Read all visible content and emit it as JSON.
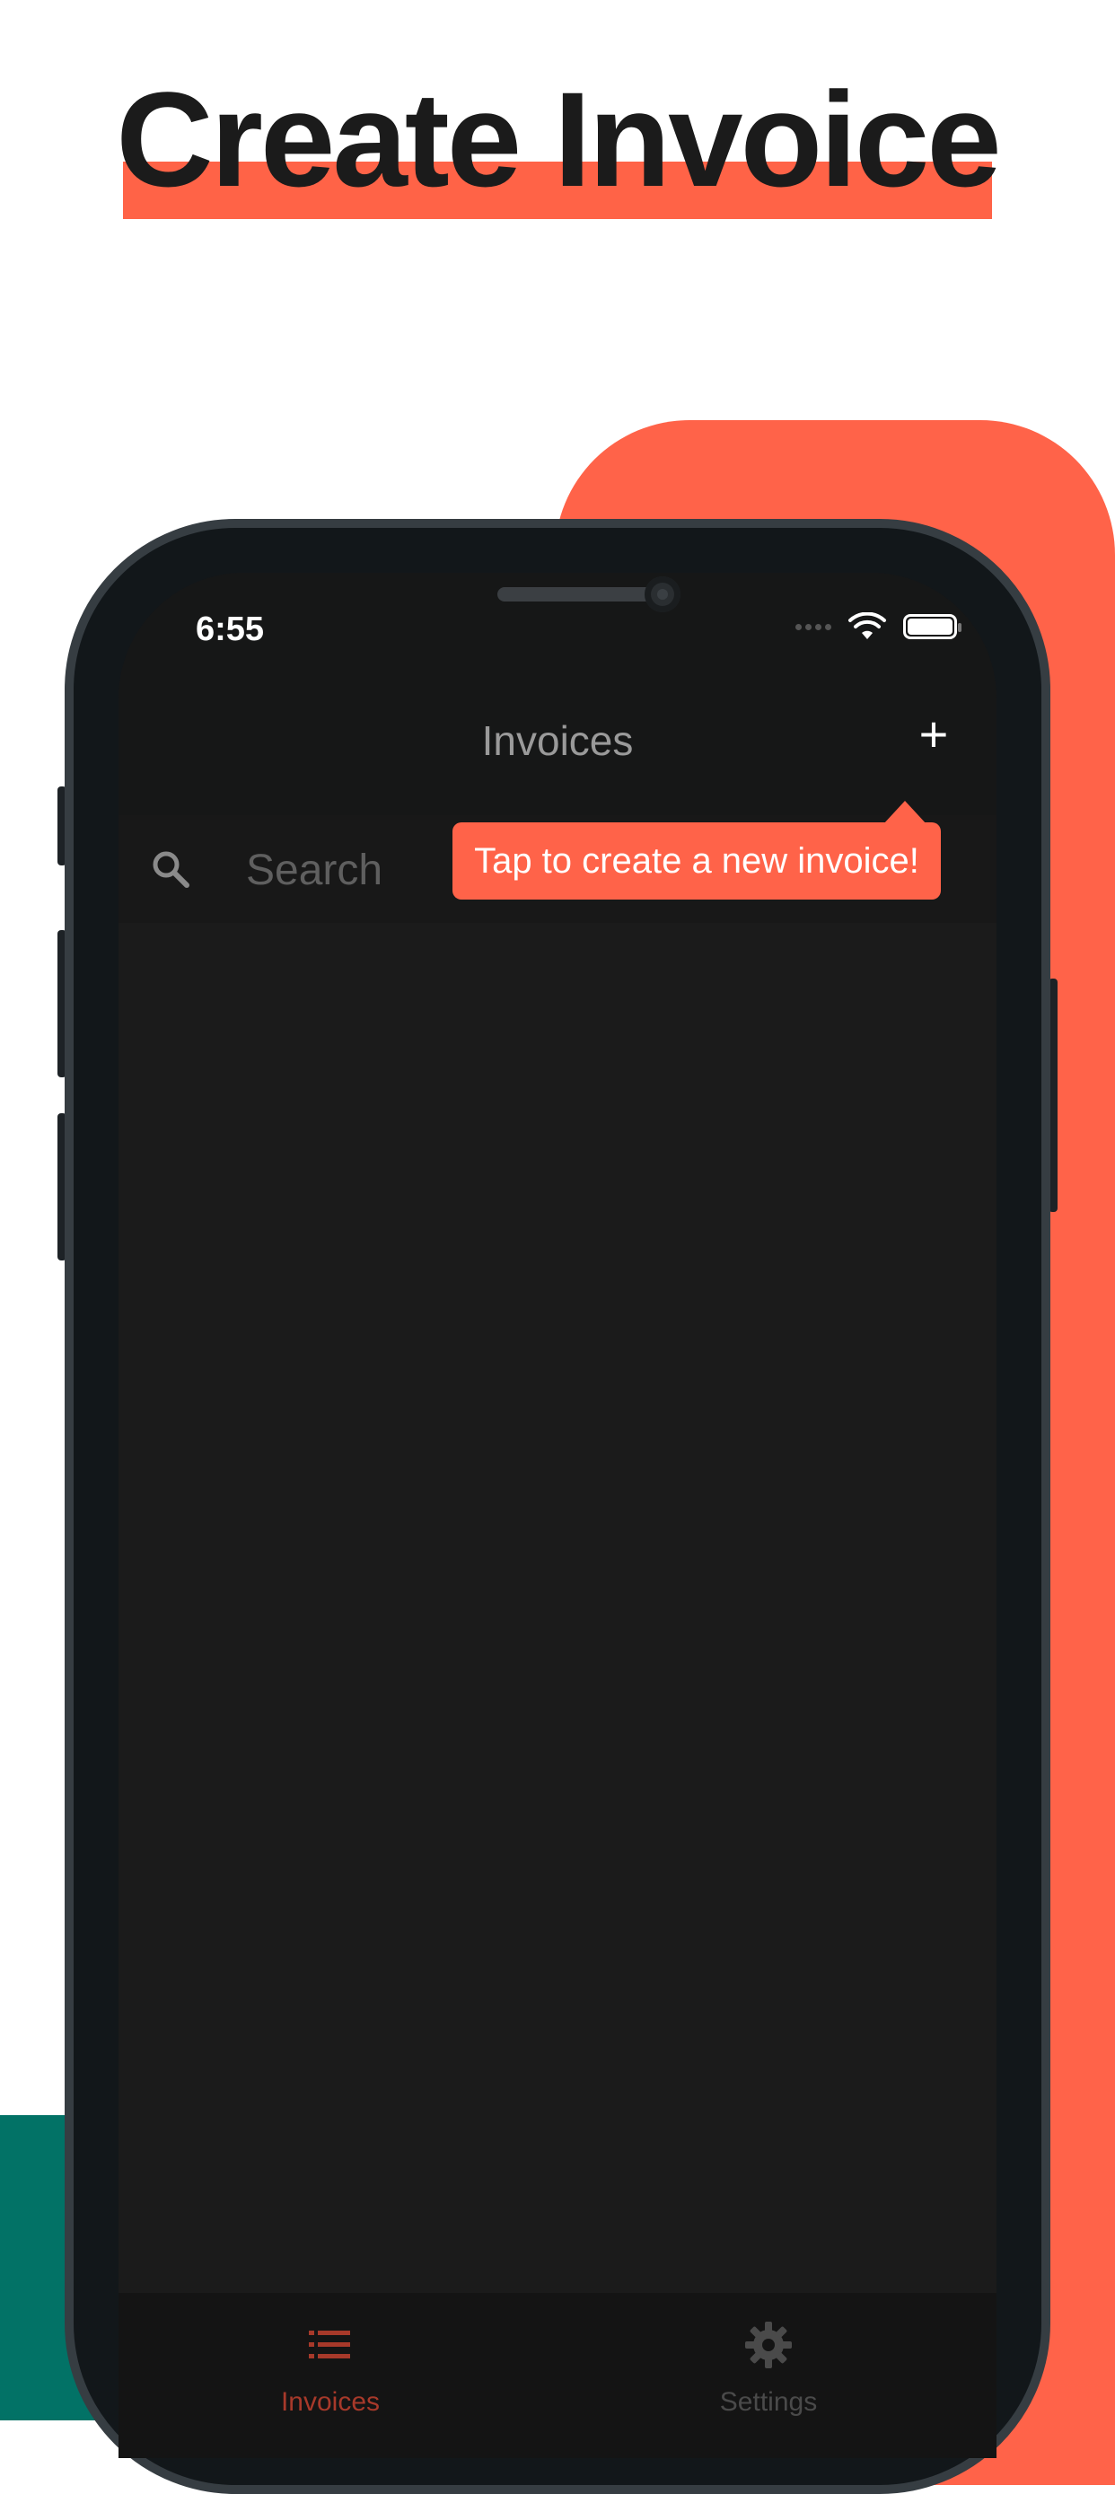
{
  "headline": "Create Invoice",
  "colors": {
    "accent": "#ff6349",
    "teal": "#027266",
    "phone_body": "#12171a",
    "screen_bg": "#1b1b1b"
  },
  "status_bar": {
    "time": "6:55",
    "icons": [
      "signal-dots-icon",
      "wifi-icon",
      "battery-icon"
    ]
  },
  "nav": {
    "title": "Invoices",
    "add_label": "+"
  },
  "search": {
    "placeholder": "Search"
  },
  "tooltip": {
    "text": "Tap to create a new invoice!"
  },
  "tabs": [
    {
      "label": "Invoices",
      "icon": "list-icon",
      "active": true
    },
    {
      "label": "Settings",
      "icon": "gear-icon",
      "active": false
    }
  ]
}
